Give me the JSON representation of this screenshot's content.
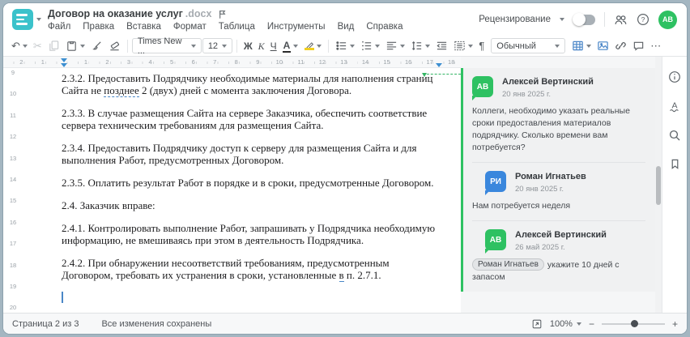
{
  "header": {
    "doc_title": "Договор на оказание услуг",
    "doc_ext": ".docx",
    "menu_items": [
      "Файл",
      "Правка",
      "Вставка",
      "Формат",
      "Таблица",
      "Инструменты",
      "Вид",
      "Справка"
    ],
    "review_label": "Рецензирование",
    "avatar_initials": "АВ"
  },
  "toolbar": {
    "undo_glyph": "↶",
    "cut_glyph": "✂",
    "font_name": "Times New ...",
    "font_size": "12",
    "bold_label": "Ж",
    "italic_label": "К",
    "underline_label": "Ч",
    "font_color_label": "А",
    "spell_letter": "А",
    "pilcrow_glyph": "¶",
    "style_label": "Обычный",
    "more_glyph": "⋯"
  },
  "rulers": {
    "horizontal": [
      "2",
      "1",
      "",
      "1",
      "2",
      "3",
      "4",
      "5",
      "6",
      "7",
      "8",
      "9",
      "10",
      "11",
      "12",
      "13",
      "14",
      "15",
      "16",
      "17",
      "18"
    ],
    "vertical": [
      "9",
      "10",
      "11",
      "12",
      "13",
      "14",
      "15",
      "16",
      "17",
      "18",
      "19",
      "20"
    ]
  },
  "document": {
    "paragraphs": [
      {
        "pre": "2.3.2. Предоставить Подрядчику необходимые материалы для наполнения страниц Сайта не ",
        "mark": "позднее",
        "post": " 2 (двух) дней с момента заключения Договора."
      },
      {
        "pre": "2.3.3. В случае размещения Сайта на сервере Заказчика, обеспечить соответствие сервера техническим требованиям для размещения Сайта."
      },
      {
        "pre": "2.3.4. Предоставить Подрядчику доступ к серверу для размещения Сайта и для выполнения Работ, предусмотренных Договором."
      },
      {
        "pre": "2.3.5. Оплатить результат Работ в порядке и в сроки, предусмотренные Договором."
      },
      {
        "pre": "2.4. Заказчик вправе:"
      },
      {
        "pre": "2.4.1. Контролировать выполнение Работ, запрашивать у Подрядчика необходимую информацию, не вмешиваясь при этом в деятельность Подрядчика."
      },
      {
        "pre": "2.4.2. При обнаружении несоответствий требованиям, предусмотренным Договором, требовать их устранения в сроки, установленные ",
        "mark": "в",
        "post": " п. 2.7.1."
      }
    ]
  },
  "comments": {
    "accent_color": "#2ec162",
    "thread": [
      {
        "initials": "АВ",
        "name": "Алексей Вертинский",
        "date": "20 янв 2025 г.",
        "text": "Коллеги, необходимо указать реальные сроки предоставления материалов подрядчику. Сколько времени вам потребуется?",
        "avatar_color": "#2ec162"
      },
      {
        "initials": "РИ",
        "name": "Роман Игнатьев",
        "date": "20 янв 2025 г.",
        "text": "Нам потребуется неделя",
        "avatar_color": "#3a87dd"
      },
      {
        "initials": "АВ",
        "name": "Алексей Вертинский",
        "date": "26 май 2025 г.",
        "mention": "Роман Игнатьев",
        "text": "укажите 10 дней с запасом",
        "avatar_color": "#2ec162"
      }
    ]
  },
  "status_bar": {
    "page_label": "Страница 2 из 3",
    "saved_label": "Все изменения сохранены",
    "zoom_value": "100%",
    "zoom_out_glyph": "−",
    "zoom_in_glyph": "+"
  }
}
